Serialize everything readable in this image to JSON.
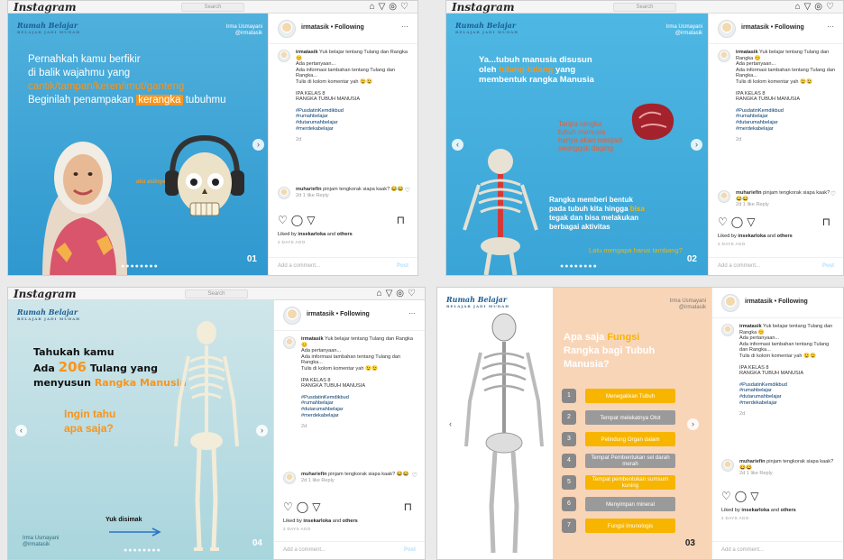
{
  "common": {
    "ig_logo": "Instagram",
    "search": "Search",
    "brand": "Rumah Belajar",
    "brand_sub": "BELAJAR JADI MUDAH",
    "author_name": "Irma Usmayani",
    "author_handle": "@irmatasik",
    "post_user": "irmatasik",
    "following": "• Following",
    "more": "···",
    "caption_user": "irmatasik",
    "caption_1": "Yuk belajar tentang Tulang dan Rangka 😊",
    "caption_2": "Ada pertanyaan...",
    "caption_3": "Ada informasi tambahan tentang Tulang dan Rangka...",
    "caption_4": "Tulis di kolom komentar yah 😉😉",
    "caption_5": "IPA KELAS 8",
    "caption_6": "RANGKA TUBUH MANUSIA",
    "tag_1": "#PusdatinKemdikbud",
    "tag_2": "#rumahbelajar",
    "tag_3": "#dutarumahbelajar",
    "tag_4": "#merdekabelajar",
    "age": "2d",
    "comment_user": "muhariefin",
    "comment_text": "pinjam tengkorak siapa kaak? 😂😂",
    "comment_meta": "2d 1 like Reply",
    "liked_prefix": "Liked by",
    "liked_user": "insekarloka",
    "liked_and": "and",
    "liked_others": "others",
    "date": "2 DAYS AGO",
    "add_comment": "Add a comment...",
    "post_btn": "Post"
  },
  "slide1": {
    "line1": "Pernahkah kamu berfikir",
    "line2": "di balik wajahmu yang",
    "line3": "cantik/tampan/keren/imut/ganteng",
    "line4a": "Beginilah penampakan",
    "line4b": "kerangka",
    "line4c": "tubuhmu",
    "face_label": "aku aslinya",
    "num": "01"
  },
  "slide2": {
    "l1a": "Ya...tubuh manusia disusun",
    "l1b": "oleh",
    "l1c": "tulang-tulang",
    "l1d": "yang",
    "l1e": "membentuk rangka Manusia",
    "t2a": "Tanpa rangka",
    "t2b": "tubuh manusia",
    "t2c": "hanya akan menjadi",
    "t2d": "seonggok daging",
    "t3a": "Rangka memberi bentuk",
    "t3b": "pada tubuh kita hingga",
    "t3c": "bisa",
    "t3d": "tegak",
    "t3e": "dan bisa melakukan",
    "t3f": "berbagai aktivitas",
    "t4": "Lalu mengapa harus tambang?",
    "num": "02"
  },
  "slide3": {
    "l1": "Tahukah kamu",
    "l2a": "Ada",
    "l2b": "206",
    "l2c": "Tulang yang",
    "l3a": "menyusun",
    "l3b": "Rangka Manusia",
    "q1": "Ingin tahu",
    "q2": "apa saja?",
    "yuk": "Yuk disimak",
    "num": "04"
  },
  "slide4": {
    "t1": "Apa saja",
    "t1b": "Fungsi",
    "t2": "Rangka bagi Tubuh",
    "t3": "Manusia?",
    "functions": [
      {
        "n": "1",
        "label": "Menegakkan Tubuh",
        "style": "yel"
      },
      {
        "n": "2",
        "label": "Tempat melekatnya Otot",
        "style": "gry"
      },
      {
        "n": "3",
        "label": "Pelindung Organ dalam",
        "style": "yel"
      },
      {
        "n": "4",
        "label": "Tempat Pembentukan sel darah merah",
        "style": "gry"
      },
      {
        "n": "5",
        "label": "Tempat pembentukan sumsum kuning",
        "style": "yel"
      },
      {
        "n": "6",
        "label": "Menyimpan mineral",
        "style": "gry"
      },
      {
        "n": "7",
        "label": "Fungsi Imunologis",
        "style": "yel"
      }
    ],
    "num": "03"
  },
  "colors": {
    "orange": "#f7941d",
    "yellow": "#f7b500",
    "sky": "#39a4d6",
    "peach": "#f9d5b8"
  }
}
